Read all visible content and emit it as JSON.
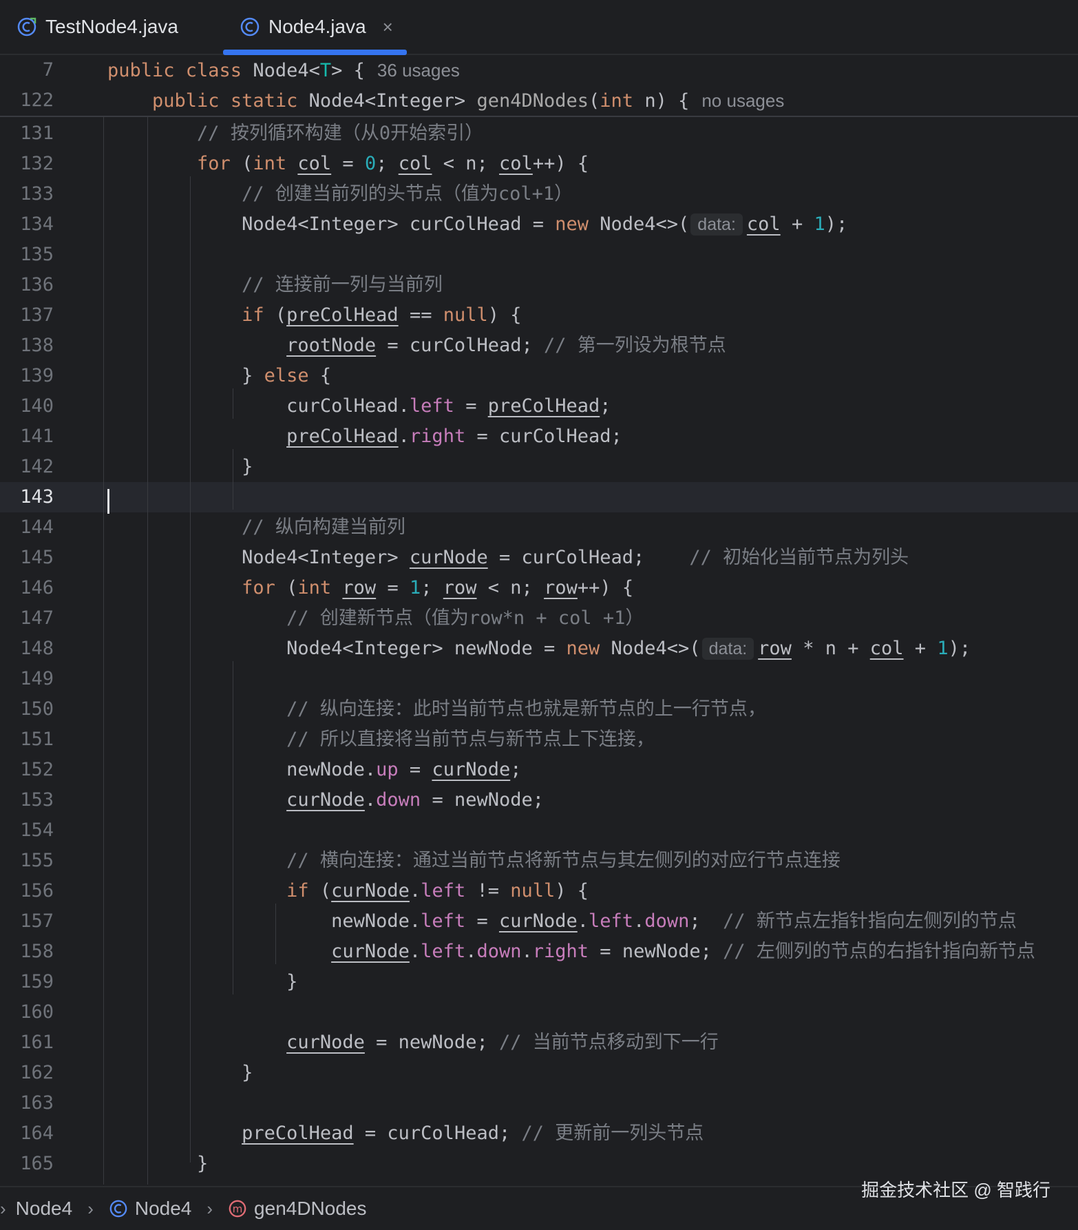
{
  "tabs": [
    {
      "label": "TestNode4.java",
      "active": false
    },
    {
      "label": "Node4.java",
      "active": true,
      "close": "×"
    }
  ],
  "sticky": [
    {
      "num": "7",
      "tokens": [
        [
          "kw",
          "public class "
        ],
        [
          "",
          "Node4<"
        ],
        [
          "tp",
          "T"
        ],
        [
          "",
          "> {"
        ]
      ],
      "usage": "36 usages"
    },
    {
      "num": "122",
      "tokens": [
        [
          "",
          "    "
        ],
        [
          "kw",
          "public static "
        ],
        [
          "",
          "Node4<Integer> "
        ],
        [
          "mth",
          "gen4DNodes"
        ],
        [
          "",
          "("
        ],
        [
          "kw",
          "int "
        ],
        [
          "",
          "n) {"
        ]
      ],
      "usage": "no usages"
    }
  ],
  "lines": [
    {
      "num": "131",
      "tokens": [
        [
          "",
          "        "
        ],
        [
          "cmt",
          "// 按列循环构建（从0开始索引）"
        ]
      ]
    },
    {
      "num": "132",
      "tokens": [
        [
          "",
          "        "
        ],
        [
          "kw",
          "for "
        ],
        [
          "",
          "("
        ],
        [
          "kw",
          "int "
        ],
        [
          "u",
          "col"
        ],
        [
          "",
          " = "
        ],
        [
          "numl",
          "0"
        ],
        [
          "",
          "; "
        ],
        [
          "u",
          "col"
        ],
        [
          "",
          " < n; "
        ],
        [
          "u",
          "col"
        ],
        [
          "",
          "++) {"
        ]
      ]
    },
    {
      "num": "133",
      "tokens": [
        [
          "",
          "            "
        ],
        [
          "cmt",
          "// 创建当前列的头节点（值为col+1）"
        ]
      ]
    },
    {
      "num": "134",
      "tokens": [
        [
          "",
          "            Node4<Integer> curColHead = "
        ],
        [
          "kw",
          "new "
        ],
        [
          "",
          "Node4<>("
        ],
        [
          "hint",
          "data:"
        ],
        [
          "u",
          "col"
        ],
        [
          "",
          " + "
        ],
        [
          "numl",
          "1"
        ],
        [
          "",
          ");"
        ]
      ]
    },
    {
      "num": "135",
      "tokens": []
    },
    {
      "num": "136",
      "tokens": [
        [
          "",
          "            "
        ],
        [
          "cmt",
          "// 连接前一列与当前列"
        ]
      ]
    },
    {
      "num": "137",
      "tokens": [
        [
          "",
          "            "
        ],
        [
          "kw",
          "if "
        ],
        [
          "",
          "("
        ],
        [
          "u",
          "preColHead"
        ],
        [
          "",
          " == "
        ],
        [
          "kw",
          "null"
        ],
        [
          "",
          ") {"
        ]
      ]
    },
    {
      "num": "138",
      "tokens": [
        [
          "",
          "                "
        ],
        [
          "u",
          "rootNode"
        ],
        [
          "",
          " = curColHead; "
        ],
        [
          "cmt",
          "// 第一列设为根节点"
        ]
      ]
    },
    {
      "num": "139",
      "tokens": [
        [
          "",
          "            } "
        ],
        [
          "kw",
          "else "
        ],
        [
          "",
          "{"
        ]
      ]
    },
    {
      "num": "140",
      "tokens": [
        [
          "",
          "                curColHead."
        ],
        [
          "fld",
          "left"
        ],
        [
          "",
          " = "
        ],
        [
          "u",
          "preColHead"
        ],
        [
          "",
          ";"
        ]
      ]
    },
    {
      "num": "141",
      "tokens": [
        [
          "",
          "                "
        ],
        [
          "u",
          "preColHead"
        ],
        [
          "",
          "."
        ],
        [
          "fld",
          "right"
        ],
        [
          "",
          " = curColHead;"
        ]
      ]
    },
    {
      "num": "142",
      "tokens": [
        [
          "",
          "            }"
        ]
      ]
    },
    {
      "num": "143",
      "tokens": [],
      "current": true
    },
    {
      "num": "144",
      "tokens": [
        [
          "",
          "            "
        ],
        [
          "cmt",
          "// 纵向构建当前列"
        ]
      ]
    },
    {
      "num": "145",
      "tokens": [
        [
          "",
          "            Node4<Integer> "
        ],
        [
          "u",
          "curNode"
        ],
        [
          "",
          " = curColHead;    "
        ],
        [
          "cmt",
          "// 初始化当前节点为列头"
        ]
      ]
    },
    {
      "num": "146",
      "tokens": [
        [
          "",
          "            "
        ],
        [
          "kw",
          "for "
        ],
        [
          "",
          "("
        ],
        [
          "kw",
          "int "
        ],
        [
          "u",
          "row"
        ],
        [
          "",
          " = "
        ],
        [
          "numl",
          "1"
        ],
        [
          "",
          "; "
        ],
        [
          "u",
          "row"
        ],
        [
          "",
          " < n; "
        ],
        [
          "u",
          "row"
        ],
        [
          "",
          "++) {"
        ]
      ]
    },
    {
      "num": "147",
      "tokens": [
        [
          "",
          "                "
        ],
        [
          "cmt",
          "// 创建新节点（值为row*n + col +1）"
        ]
      ]
    },
    {
      "num": "148",
      "tokens": [
        [
          "",
          "                Node4<Integer> newNode = "
        ],
        [
          "kw",
          "new "
        ],
        [
          "",
          "Node4<>("
        ],
        [
          "hint",
          "data:"
        ],
        [
          "u",
          "row"
        ],
        [
          "",
          " * n + "
        ],
        [
          "u",
          "col"
        ],
        [
          "",
          " + "
        ],
        [
          "numl",
          "1"
        ],
        [
          "",
          ");"
        ]
      ]
    },
    {
      "num": "149",
      "tokens": []
    },
    {
      "num": "150",
      "tokens": [
        [
          "",
          "                "
        ],
        [
          "cmt",
          "// 纵向连接：此时当前节点也就是新节点的上一行节点，"
        ]
      ]
    },
    {
      "num": "151",
      "tokens": [
        [
          "",
          "                "
        ],
        [
          "cmt",
          "// 所以直接将当前节点与新节点上下连接，"
        ]
      ]
    },
    {
      "num": "152",
      "tokens": [
        [
          "",
          "                newNode."
        ],
        [
          "fld",
          "up"
        ],
        [
          "",
          " = "
        ],
        [
          "u",
          "curNode"
        ],
        [
          "",
          ";"
        ]
      ]
    },
    {
      "num": "153",
      "tokens": [
        [
          "",
          "                "
        ],
        [
          "u",
          "curNode"
        ],
        [
          "",
          "."
        ],
        [
          "fld",
          "down"
        ],
        [
          "",
          " = newNode;"
        ]
      ]
    },
    {
      "num": "154",
      "tokens": []
    },
    {
      "num": "155",
      "tokens": [
        [
          "",
          "                "
        ],
        [
          "cmt",
          "// 横向连接：通过当前节点将新节点与其左侧列的对应行节点连接"
        ]
      ]
    },
    {
      "num": "156",
      "tokens": [
        [
          "",
          "                "
        ],
        [
          "kw",
          "if "
        ],
        [
          "",
          "("
        ],
        [
          "u",
          "curNode"
        ],
        [
          "",
          "."
        ],
        [
          "fld",
          "left"
        ],
        [
          "",
          " != "
        ],
        [
          "kw",
          "null"
        ],
        [
          "",
          ") {"
        ]
      ]
    },
    {
      "num": "157",
      "tokens": [
        [
          "",
          "                    newNode."
        ],
        [
          "fld",
          "left"
        ],
        [
          "",
          " = "
        ],
        [
          "u",
          "curNode"
        ],
        [
          "",
          "."
        ],
        [
          "fld",
          "left"
        ],
        [
          "",
          "."
        ],
        [
          "fld",
          "down"
        ],
        [
          "",
          ";  "
        ],
        [
          "cmt",
          "// 新节点左指针指向左侧列的节点"
        ]
      ]
    },
    {
      "num": "158",
      "tokens": [
        [
          "",
          "                    "
        ],
        [
          "u",
          "curNode"
        ],
        [
          "",
          "."
        ],
        [
          "fld",
          "left"
        ],
        [
          "",
          "."
        ],
        [
          "fld",
          "down"
        ],
        [
          "",
          "."
        ],
        [
          "fld",
          "right"
        ],
        [
          "",
          " = newNode; "
        ],
        [
          "cmt",
          "// 左侧列的节点的右指针指向新节点"
        ]
      ]
    },
    {
      "num": "159",
      "tokens": [
        [
          "",
          "                }"
        ]
      ]
    },
    {
      "num": "160",
      "tokens": []
    },
    {
      "num": "161",
      "tokens": [
        [
          "",
          "                "
        ],
        [
          "u",
          "curNode"
        ],
        [
          "",
          " = newNode; "
        ],
        [
          "cmt",
          "// 当前节点移动到下一行"
        ]
      ]
    },
    {
      "num": "162",
      "tokens": [
        [
          "",
          "            }"
        ]
      ]
    },
    {
      "num": "163",
      "tokens": []
    },
    {
      "num": "164",
      "tokens": [
        [
          "",
          "            "
        ],
        [
          "u",
          "preColHead"
        ],
        [
          "",
          " = curColHead; "
        ],
        [
          "cmt",
          "// 更新前一列头节点"
        ]
      ]
    },
    {
      "num": "165",
      "tokens": [
        [
          "",
          "        }"
        ]
      ]
    }
  ],
  "breadcrumb": {
    "items": [
      "Node4",
      "Node4",
      "gen4DNodes"
    ],
    "sep": "›"
  },
  "watermark": "掘金技术社区 @ 智践行",
  "colors": {
    "accent": "#3574f0",
    "keyword": "#cf8e6d",
    "field": "#c77dbb",
    "number": "#2aacb8",
    "comment": "#7a7e85"
  }
}
